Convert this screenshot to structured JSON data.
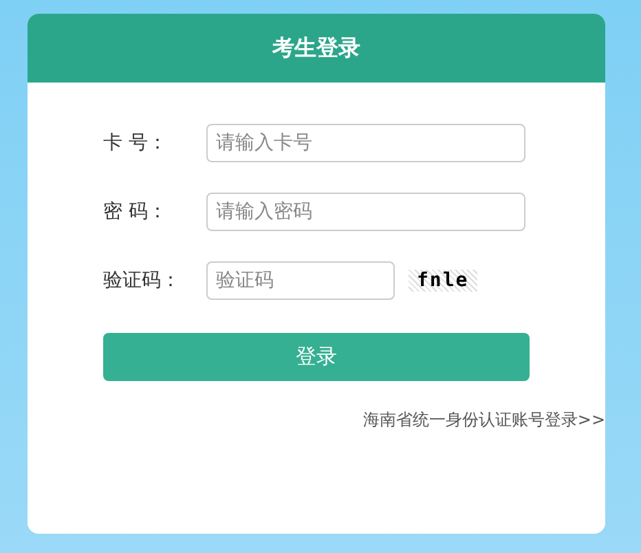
{
  "title": "考生登录",
  "fields": [
    {
      "label": "卡 号：",
      "placeholder": "请输入卡号",
      "kind": "text"
    },
    {
      "label": "密 码：",
      "placeholder": "请输入密码",
      "kind": "password"
    },
    {
      "label": "验证码：",
      "placeholder": "验证码",
      "kind": "captcha",
      "captcha": "fnle"
    }
  ],
  "submit": "登录",
  "link": "海南省统一身份认证账号登录>>"
}
